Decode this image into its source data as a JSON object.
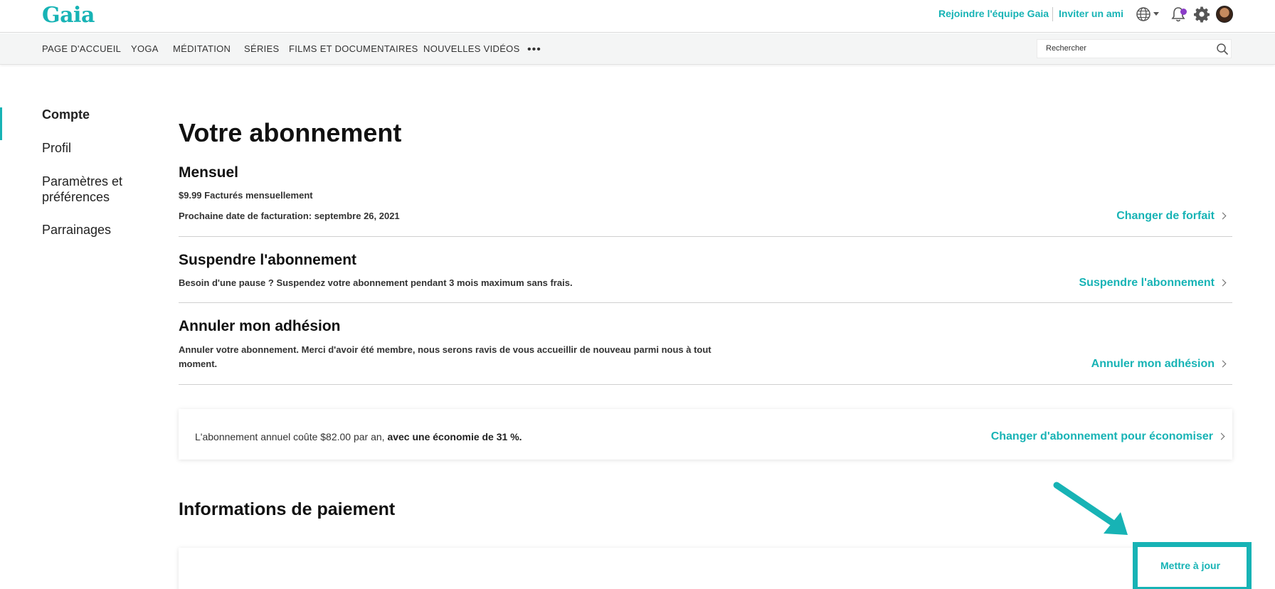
{
  "header": {
    "logo": "Gaia",
    "join_team": "Rejoindre l'équipe Gaia",
    "invite_friend": "Inviter un ami"
  },
  "nav": {
    "items": [
      "PAGE D'ACCUEIL",
      "YOGA",
      "MÉDITATION",
      "SÉRIES",
      "FILMS ET DOCUMENTAIRES",
      "NOUVELLES VIDÉOS"
    ],
    "more": "•••",
    "search_placeholder": "Rechercher"
  },
  "sidebar": {
    "items": [
      {
        "label": "Compte",
        "active": true
      },
      {
        "label": "Profil"
      },
      {
        "label": "Paramètres et"
      },
      {
        "label": "préférences"
      },
      {
        "label": "Parrainages"
      }
    ]
  },
  "main": {
    "title": "Votre abonnement",
    "plan": {
      "title": "Mensuel",
      "price": "$9.99 Facturés mensuellement",
      "next_billing": "Prochaine date de facturation: septembre 26, 2021",
      "action": "Changer de forfait"
    },
    "pause": {
      "title": "Suspendre l'abonnement",
      "text": "Besoin d'une pause ? Suspendez votre abonnement pendant 3 mois maximum sans frais.",
      "action": "Suspendre l'abonnement"
    },
    "cancel": {
      "title": "Annuler mon adhésion",
      "text_line1": "Annuler votre abonnement. Merci d'avoir été membre, nous serons ravis de vous accueillir de nouveau parmi nous à tout",
      "text_line2": "moment.",
      "action": "Annuler mon adhésion"
    },
    "promo": {
      "text": "L'abonnement annuel coûte $82.00 par an,",
      "bold": "avec une économie de 31 %.",
      "action": "Changer d'abonnement pour économiser"
    },
    "payment": {
      "title": "Informations de paiement",
      "update": "Mettre à jour"
    }
  },
  "colors": {
    "accent": "#17b3b5",
    "notification": "#8a3cc7"
  }
}
